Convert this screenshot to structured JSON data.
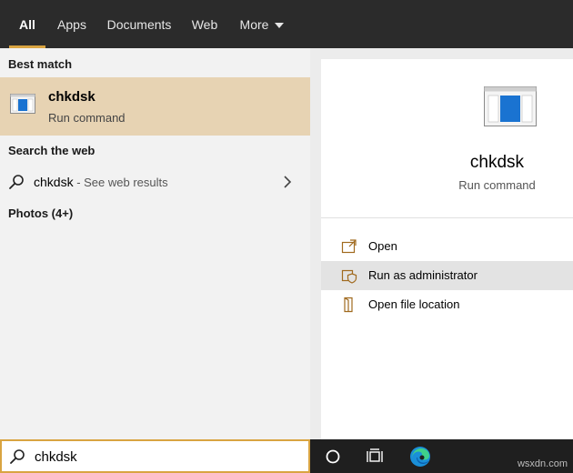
{
  "tabs": [
    {
      "label": "All"
    },
    {
      "label": "Apps"
    },
    {
      "label": "Documents"
    },
    {
      "label": "Web"
    },
    {
      "label": "More"
    }
  ],
  "results": {
    "best_match_label": "Best match",
    "best_match": {
      "title": "chkdsk",
      "subtitle": "Run command"
    },
    "search_web_label": "Search the web",
    "web_result": {
      "term": "chkdsk",
      "suffix": " - See web results"
    },
    "photos_label": "Photos (4+)"
  },
  "details": {
    "title": "chkdsk",
    "subtitle": "Run command",
    "actions": [
      {
        "label": "Open",
        "icon": "open-icon"
      },
      {
        "label": "Run as administrator",
        "icon": "shield-icon"
      },
      {
        "label": "Open file location",
        "icon": "file-location-icon"
      }
    ]
  },
  "search": {
    "value": "chkdsk"
  },
  "taskbar": {
    "icons": [
      "cortana-circle-icon",
      "task-view-icon",
      "edge-browser-icon"
    ]
  },
  "watermark": "wsxdn.com",
  "colors": {
    "accent": "#d9a441",
    "selected_row": "#e7d3b3",
    "topbar": "#2b2b2b",
    "taskbar": "#1f1f1f"
  }
}
